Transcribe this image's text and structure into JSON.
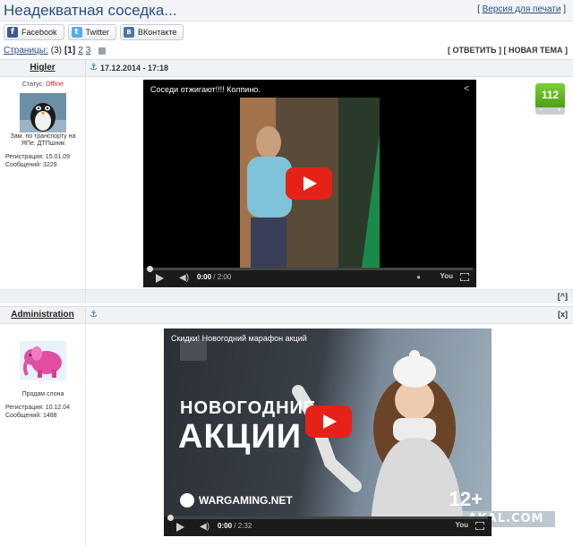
{
  "header": {
    "title": "Неадекватная соседка...",
    "print_link": "Версия для печати"
  },
  "share": {
    "facebook": "Facebook",
    "twitter": "Twitter",
    "vkontakte": "ВКонтакте"
  },
  "pagination": {
    "label": "Страницы:",
    "total": "(3)",
    "current": "[1]",
    "page2": "2",
    "page3": "3"
  },
  "actions": {
    "reply": "[ ОТВЕТИТЬ ]",
    "new_topic": "[ НОВАЯ ТЕМА ]"
  },
  "posts": [
    {
      "author": "Higler",
      "date": "17.12.2014 - 17:18",
      "status_label": "Статус:",
      "status_value": "Offline",
      "user_title": "Зам. по транспорту на ЯПе. ДТПшник",
      "registration": "Регистрация: 15.01.09",
      "messages": "Сообщений: 3229",
      "rating": "112",
      "video": {
        "title": "Соседи отжигают!!!! Колпино.",
        "time_current": "0:00",
        "time_total": "/ 2:00"
      },
      "up_button": "[^]"
    },
    {
      "author": "Administration",
      "user_title": "Продам слона",
      "registration": "Регистрация: 10.12.04",
      "messages": "Сообщений: 1488",
      "close_button": "[x]",
      "video": {
        "title": "Скидки! Новогодний марафон акций",
        "ad_line1": "НОВОГОДНИЕ",
        "ad_line2": "АКЦИИ",
        "brand": "WARGAMING.NET",
        "age": "12+",
        "time_current": "0:00",
        "time_total": "/ 2:32"
      }
    }
  ],
  "watermark": "YAPLAKAL.COM",
  "icons": {
    "anchor": "anchor-icon",
    "share": "share-icon",
    "play": "play-icon"
  },
  "colors": {
    "title": "#2a4f83",
    "offline": "#dd2222",
    "rating": "#5aa91f",
    "youtube_red": "#e62117"
  }
}
